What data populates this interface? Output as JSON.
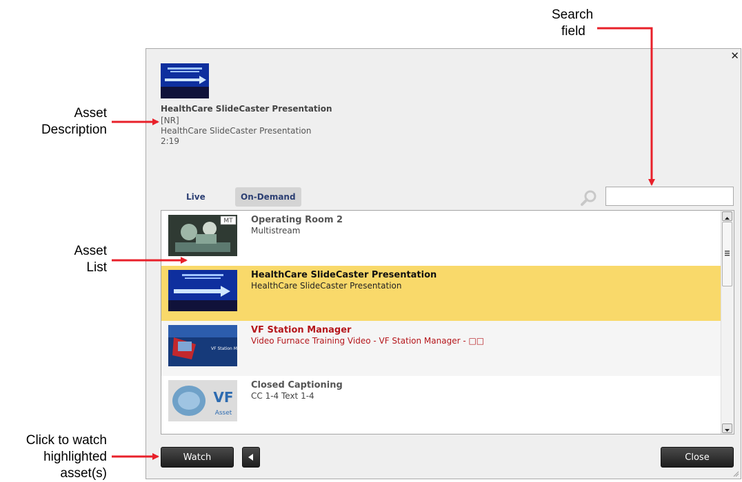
{
  "callouts": {
    "search": [
      "Search",
      "field"
    ],
    "asset_description": [
      "Asset",
      "Description"
    ],
    "asset_list": [
      "Asset",
      "List"
    ],
    "watch": [
      "Click to watch",
      "highlighted",
      "asset(s)"
    ]
  },
  "dialog": {
    "close_glyph": "✕",
    "description": {
      "title": "HealthCare SlideCaster Presentation",
      "rating": "[NR]",
      "subtitle": "HealthCare SlideCaster Presentation",
      "duration": "2:19"
    },
    "tabs": [
      {
        "label": "Live",
        "active": false
      },
      {
        "label": "On-Demand",
        "active": true
      }
    ],
    "search": {
      "value": "",
      "placeholder": ""
    },
    "assets": [
      {
        "title": "Operating Room 2",
        "subtitle": "Multistream",
        "badge": "MT",
        "state": "normal"
      },
      {
        "title": "HealthCare SlideCaster Presentation",
        "subtitle": "HealthCare SlideCaster Presentation",
        "state": "selected"
      },
      {
        "title": "VF Station Manager",
        "subtitle": "Video Furnace Training Video - VF Station Manager - □□",
        "state": "red"
      },
      {
        "title": "Closed Captioning",
        "subtitle": "CC 1-4 Text 1-4",
        "state": "normal"
      }
    ],
    "buttons": {
      "watch": "Watch",
      "close": "Close"
    }
  },
  "colors": {
    "accent_tab": "#2c3f73",
    "selected_row": "#f9d96a",
    "error_text": "#b5161b",
    "arrow": "#e8202a"
  }
}
